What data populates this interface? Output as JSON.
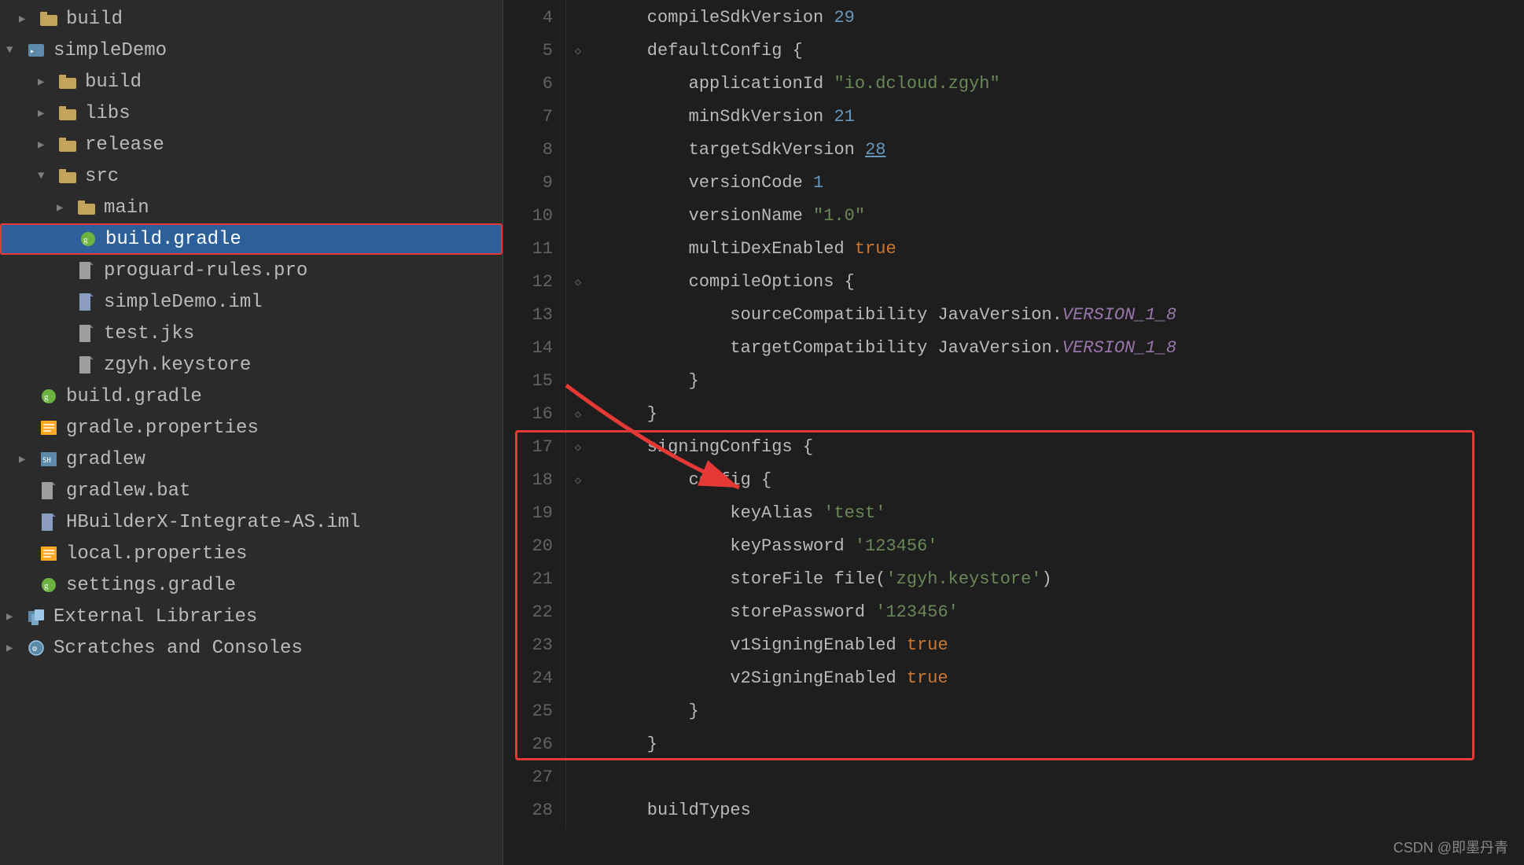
{
  "sidebar": {
    "items": [
      {
        "id": "build-top",
        "label": "build",
        "type": "folder",
        "indent": 1,
        "expanded": false
      },
      {
        "id": "simpleDemo",
        "label": "simpleDemo",
        "type": "folder-module",
        "indent": 0,
        "expanded": true
      },
      {
        "id": "build",
        "label": "build",
        "type": "folder",
        "indent": 2,
        "expanded": false
      },
      {
        "id": "libs",
        "label": "libs",
        "type": "folder",
        "indent": 2,
        "expanded": false
      },
      {
        "id": "release",
        "label": "release",
        "type": "folder",
        "indent": 2,
        "expanded": false
      },
      {
        "id": "src",
        "label": "src",
        "type": "folder",
        "indent": 2,
        "expanded": true
      },
      {
        "id": "main",
        "label": "main",
        "type": "folder",
        "indent": 3,
        "expanded": false
      },
      {
        "id": "build.gradle",
        "label": "build.gradle",
        "type": "gradle-file",
        "indent": 3,
        "expanded": false,
        "selected": true,
        "highlighted": true
      },
      {
        "id": "proguard-rules.pro",
        "label": "proguard-rules.pro",
        "type": "file",
        "indent": 3
      },
      {
        "id": "simpleDemo.iml",
        "label": "simpleDemo.iml",
        "type": "iml-file",
        "indent": 3
      },
      {
        "id": "test.jks",
        "label": "test.jks",
        "type": "file",
        "indent": 3
      },
      {
        "id": "zgyh.keystore",
        "label": "zgyh.keystore",
        "type": "file",
        "indent": 3
      },
      {
        "id": "build.gradle-root",
        "label": "build.gradle",
        "type": "gradle-root",
        "indent": 1
      },
      {
        "id": "gradle.properties",
        "label": "gradle.properties",
        "type": "properties",
        "indent": 1
      },
      {
        "id": "gradlew",
        "label": "gradlew",
        "type": "gradlew",
        "indent": 1
      },
      {
        "id": "gradlew.bat",
        "label": "gradlew.bat",
        "type": "file",
        "indent": 1
      },
      {
        "id": "HBuilderX-Integrate-AS.iml",
        "label": "HBuilderX-Integrate-AS.iml",
        "type": "iml-file",
        "indent": 1
      },
      {
        "id": "local.properties",
        "label": "local.properties",
        "type": "properties",
        "indent": 1
      },
      {
        "id": "settings.gradle",
        "label": "settings.gradle",
        "type": "gradle-settings",
        "indent": 1
      },
      {
        "id": "external-libraries",
        "label": "External Libraries",
        "type": "external",
        "indent": 0,
        "expanded": false
      },
      {
        "id": "scratches",
        "label": "Scratches and Consoles",
        "type": "scratches",
        "indent": 0,
        "expanded": false
      }
    ]
  },
  "editor": {
    "lines": [
      {
        "num": 4,
        "gutter": "",
        "code": [
          {
            "text": "    compileSdkVersion ",
            "cls": "plain"
          },
          {
            "text": "29",
            "cls": "num"
          }
        ]
      },
      {
        "num": 5,
        "gutter": "◇",
        "code": [
          {
            "text": "    defaultConfig {",
            "cls": "plain"
          }
        ]
      },
      {
        "num": 6,
        "gutter": "",
        "code": [
          {
            "text": "        applicationId ",
            "cls": "plain"
          },
          {
            "text": "\"io.dcloud.zgyh\"",
            "cls": "str"
          }
        ]
      },
      {
        "num": 7,
        "gutter": "",
        "code": [
          {
            "text": "        minSdkVersion ",
            "cls": "plain"
          },
          {
            "text": "21",
            "cls": "num"
          }
        ]
      },
      {
        "num": 8,
        "gutter": "",
        "code": [
          {
            "text": "        targetSdkVersion ",
            "cls": "plain"
          },
          {
            "text": "28",
            "cls": "num"
          }
        ]
      },
      {
        "num": 9,
        "gutter": "",
        "code": [
          {
            "text": "        versionCode ",
            "cls": "plain"
          },
          {
            "text": "1",
            "cls": "num"
          }
        ]
      },
      {
        "num": 10,
        "gutter": "",
        "code": [
          {
            "text": "        versionName ",
            "cls": "plain"
          },
          {
            "text": "\"1.0\"",
            "cls": "str"
          }
        ]
      },
      {
        "num": 11,
        "gutter": "",
        "code": [
          {
            "text": "        multiDexEnabled ",
            "cls": "plain"
          },
          {
            "text": "true",
            "cls": "kw"
          }
        ]
      },
      {
        "num": 12,
        "gutter": "◇",
        "code": [
          {
            "text": "        compileOptions {",
            "cls": "plain"
          }
        ]
      },
      {
        "num": 13,
        "gutter": "",
        "code": [
          {
            "text": "            sourceCompatibility JavaVersion.",
            "cls": "plain"
          },
          {
            "text": "VERSION_1_8",
            "cls": "it"
          }
        ]
      },
      {
        "num": 14,
        "gutter": "",
        "code": [
          {
            "text": "            targetCompatibility JavaVersion.",
            "cls": "plain"
          },
          {
            "text": "VERSION_1_8",
            "cls": "it"
          }
        ]
      },
      {
        "num": 15,
        "gutter": "",
        "code": [
          {
            "text": "        }",
            "cls": "brace"
          }
        ]
      },
      {
        "num": 16,
        "gutter": "◇",
        "code": [
          {
            "text": "    }",
            "cls": "brace"
          }
        ]
      },
      {
        "num": 17,
        "gutter": "◇",
        "code": [
          {
            "text": "    signingConfigs {",
            "cls": "plain"
          }
        ]
      },
      {
        "num": 18,
        "gutter": "◇",
        "code": [
          {
            "text": "        config {",
            "cls": "plain"
          }
        ]
      },
      {
        "num": 19,
        "gutter": "",
        "code": [
          {
            "text": "            keyAlias ",
            "cls": "plain"
          },
          {
            "text": "'test'",
            "cls": "str"
          }
        ]
      },
      {
        "num": 20,
        "gutter": "",
        "code": [
          {
            "text": "            keyPassword ",
            "cls": "plain"
          },
          {
            "text": "'123456'",
            "cls": "str"
          }
        ]
      },
      {
        "num": 21,
        "gutter": "",
        "code": [
          {
            "text": "            storeFile file(",
            "cls": "plain"
          },
          {
            "text": "'zgyh.keystore'",
            "cls": "str"
          },
          {
            "text": ")",
            "cls": "plain"
          }
        ]
      },
      {
        "num": 22,
        "gutter": "",
        "code": [
          {
            "text": "            storePassword ",
            "cls": "plain"
          },
          {
            "text": "'123456'",
            "cls": "str"
          }
        ]
      },
      {
        "num": 23,
        "gutter": "",
        "code": [
          {
            "text": "            v1SigningEnabled ",
            "cls": "plain"
          },
          {
            "text": "true",
            "cls": "kw"
          }
        ]
      },
      {
        "num": 24,
        "gutter": "",
        "code": [
          {
            "text": "            v2SigningEnabled ",
            "cls": "plain"
          },
          {
            "text": "true",
            "cls": "kw"
          }
        ]
      },
      {
        "num": 25,
        "gutter": "",
        "code": [
          {
            "text": "        }",
            "cls": "brace"
          }
        ]
      },
      {
        "num": 26,
        "gutter": "",
        "code": [
          {
            "text": "    }",
            "cls": "brace"
          }
        ]
      },
      {
        "num": 27,
        "gutter": "",
        "code": [
          {
            "text": "",
            "cls": "plain"
          }
        ]
      },
      {
        "num": 28,
        "gutter": "",
        "code": [
          {
            "text": "    buildTypes",
            "cls": "plain"
          }
        ]
      }
    ]
  },
  "watermark": "CSDN @即墨丹青"
}
